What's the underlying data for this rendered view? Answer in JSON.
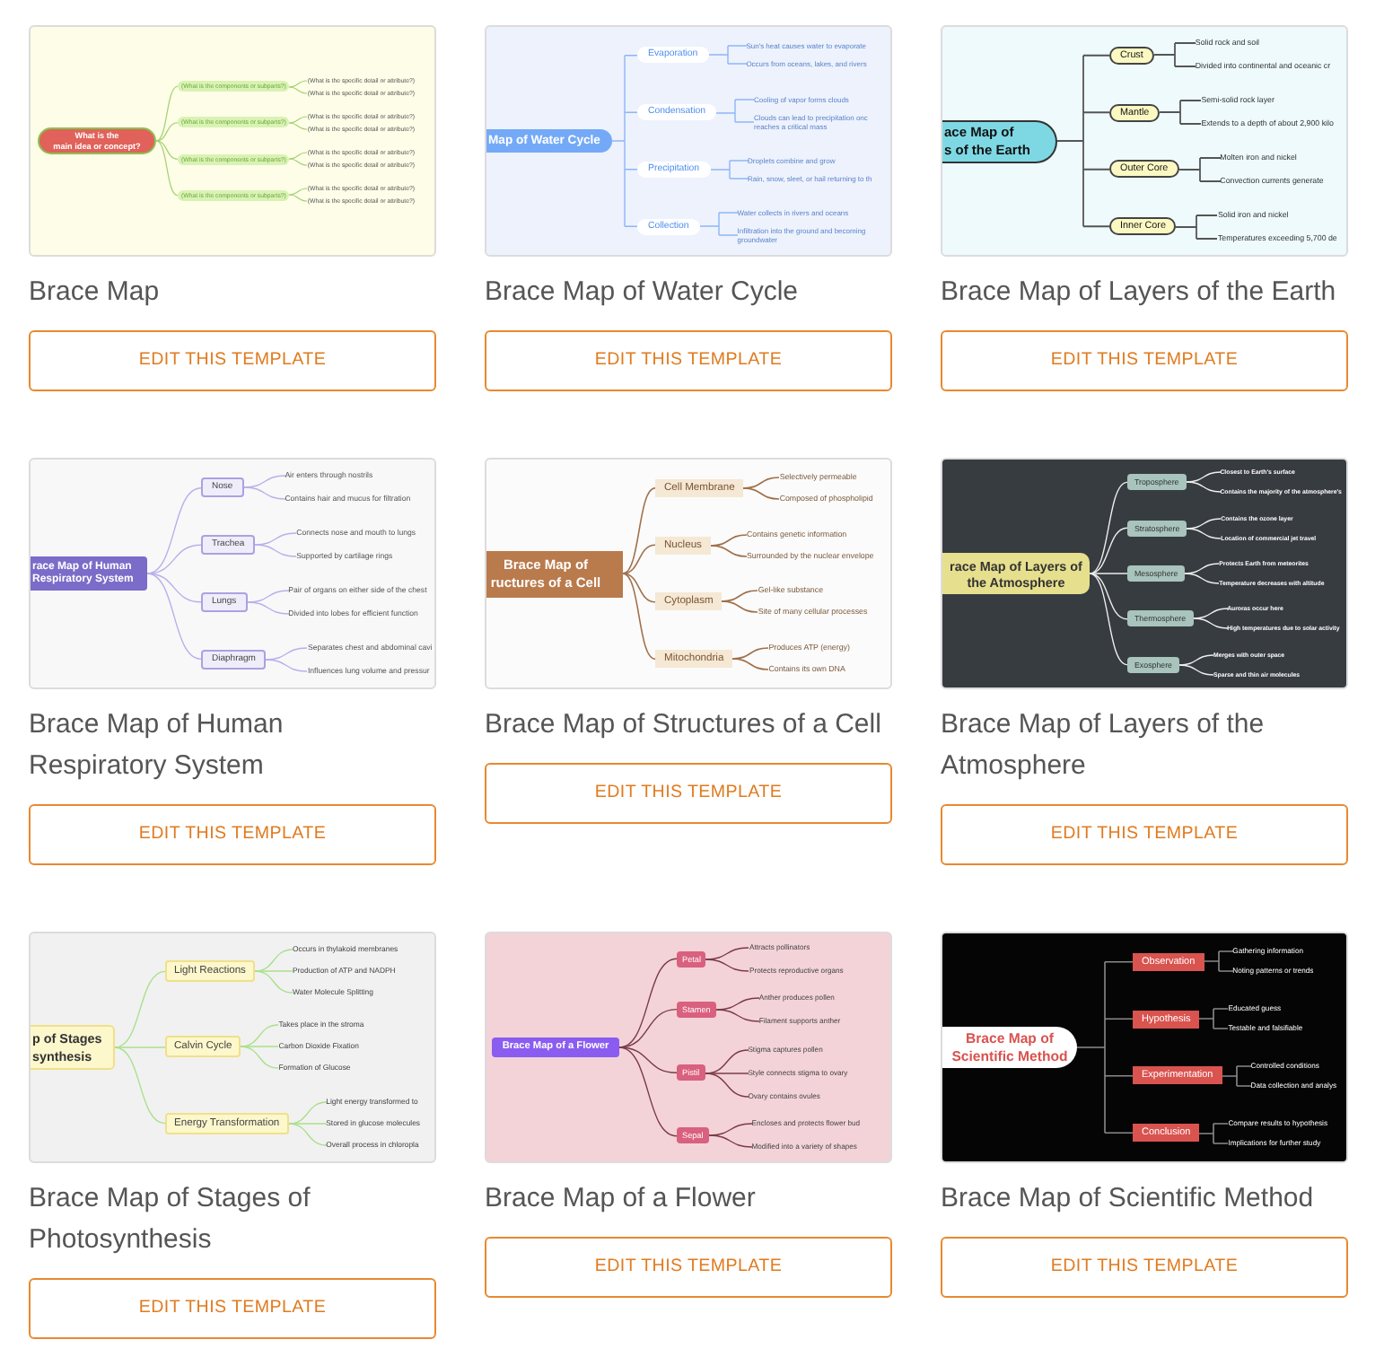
{
  "templates": [
    {
      "title": "Brace Map",
      "preview": {
        "kind": "curved",
        "root": "What is the\nmain idea or concept?",
        "branches": [
          {
            "label": "(What is the components or subparts?)",
            "details": [
              "(What is the specific detail or attribute?)",
              "(What is the specific detail or attribute?)"
            ]
          },
          {
            "label": "(What is the components or subparts?)",
            "details": [
              "(What is the specific detail or attribute?)",
              "(What is the specific detail or attribute?)"
            ]
          },
          {
            "label": "(What is the components or subparts?)",
            "details": [
              "(What is the specific detail or attribute?)",
              "(What is the specific detail or attribute?)"
            ]
          },
          {
            "label": "(What is the components or subparts?)",
            "details": [
              "(What is the specific detail or attribute?)",
              "(What is the specific detail or attribute?)"
            ]
          }
        ]
      },
      "button": "EDIT THIS TEMPLATE"
    },
    {
      "title": "Brace Map of Water Cycle",
      "preview": {
        "kind": "angular",
        "root": "Map of Water Cycle",
        "branches": [
          {
            "label": "Evaporation",
            "details": [
              "Sun's heat causes water to evaporate",
              "Occurs from oceans, lakes, and rivers"
            ]
          },
          {
            "label": "Condensation",
            "details": [
              "Cooling of vapor forms clouds",
              "Clouds can lead to precipitation onc\nreaches a critical mass"
            ]
          },
          {
            "label": "Precipitation",
            "details": [
              "Droplets combine and grow",
              "Rain, snow, sleet, or hail returning to th"
            ]
          },
          {
            "label": "Collection",
            "details": [
              "Water collects in rivers and oceans",
              "Infiltration into the ground and becoming\ngroundwater"
            ]
          }
        ]
      },
      "button": "EDIT THIS TEMPLATE"
    },
    {
      "title": "Brace Map of Layers of the Earth",
      "preview": {
        "kind": "angular",
        "root": "ace Map of\ns of the Earth",
        "branches": [
          {
            "label": "Crust",
            "details": [
              "Solid rock and soil",
              "Divided into continental and oceanic cr"
            ]
          },
          {
            "label": "Mantle",
            "details": [
              "Semi-solid rock layer",
              "Extends to a depth of about 2,900 kilo"
            ]
          },
          {
            "label": "Outer Core",
            "details": [
              "Molten iron and nickel",
              "Convection currents generate"
            ]
          },
          {
            "label": "Inner Core",
            "details": [
              "Solid iron and nickel",
              "Temperatures exceeding 5,700 de"
            ]
          }
        ]
      },
      "button": "EDIT THIS TEMPLATE"
    },
    {
      "title": "Brace Map of Human Respiratory System",
      "preview": {
        "kind": "curved",
        "root": "race Map of Human\nRespiratory System",
        "branches": [
          {
            "label": "Nose",
            "details": [
              "Air enters through nostrils",
              "Contains hair and mucus for filtration"
            ]
          },
          {
            "label": "Trachea",
            "details": [
              "Connects nose and mouth to lungs",
              "Supported by cartilage rings"
            ]
          },
          {
            "label": "Lungs",
            "details": [
              "Pair of organs on either side of the chest",
              "Divided into lobes for efficient function"
            ]
          },
          {
            "label": "Diaphragm",
            "details": [
              "Separates chest and abdominal cavi",
              "Influences lung volume and pressur"
            ]
          }
        ]
      },
      "button": "EDIT THIS TEMPLATE"
    },
    {
      "title": "Brace Map of Structures of a Cell",
      "preview": {
        "kind": "curved",
        "root": "Brace Map of\nructures of a Cell",
        "branches": [
          {
            "label": "Cell Membrane",
            "details": [
              "Selectively permeable",
              "Composed of phospholipid"
            ]
          },
          {
            "label": "Nucleus",
            "details": [
              "Contains genetic information",
              "Surrounded by the nuclear envelope"
            ]
          },
          {
            "label": "Cytoplasm",
            "details": [
              "Gel-like substance",
              "Site of many cellular processes"
            ]
          },
          {
            "label": "Mitochondria",
            "details": [
              "Produces ATP (energy)",
              "Contains its own DNA"
            ]
          }
        ]
      },
      "button": "EDIT THIS TEMPLATE"
    },
    {
      "title": "Brace Map of Layers of the Atmosphere",
      "preview": {
        "kind": "curved",
        "root": "race Map of Layers of\nthe Atmosphere",
        "branches": [
          {
            "label": "Troposphere",
            "details": [
              "Closest to Earth's surface",
              "Contains the majority of the atmosphere's"
            ]
          },
          {
            "label": "Stratosphere",
            "details": [
              "Contains the ozone layer",
              "Location of commercial jet travel"
            ]
          },
          {
            "label": "Mesosphere",
            "details": [
              "Protects Earth from meteorites",
              "Temperature decreases with altitude"
            ]
          },
          {
            "label": "Thermosphere",
            "details": [
              "Auroras occur here",
              "High temperatures due to solar activity"
            ]
          },
          {
            "label": "Exosphere",
            "details": [
              "Merges with outer space",
              "Sparse and thin air molecules"
            ]
          }
        ]
      },
      "button": "EDIT THIS TEMPLATE"
    },
    {
      "title": "Brace Map of Stages of Photosynthesis",
      "preview": {
        "kind": "curved",
        "root": "p of Stages\nsynthesis",
        "branches": [
          {
            "label": "Light Reactions",
            "details": [
              "Occurs in thylakoid membranes",
              "Production of ATP and NADPH",
              "Water Molecule Splitting"
            ]
          },
          {
            "label": "Calvin Cycle",
            "details": [
              "Takes place in the stroma",
              "Carbon Dioxide Fixation",
              "Formation of Glucose"
            ]
          },
          {
            "label": "Energy Transformation",
            "details": [
              "Light energy transformed to",
              "Stored in glucose molecules",
              "Overall process in chloropla"
            ]
          }
        ]
      },
      "button": "EDIT THIS TEMPLATE"
    },
    {
      "title": "Brace Map of a Flower",
      "preview": {
        "kind": "curved",
        "root": "Brace Map of a Flower",
        "branches": [
          {
            "label": "Petal",
            "details": [
              "Attracts pollinators",
              "Protects reproductive organs"
            ]
          },
          {
            "label": "Stamen",
            "details": [
              "Anther produces pollen",
              "Filament supports anther"
            ]
          },
          {
            "label": "Pistil",
            "details": [
              "Stigma captures pollen",
              "Style connects stigma to ovary",
              "Ovary contains ovules"
            ]
          },
          {
            "label": "Sepal",
            "details": [
              "Encloses and protects flower bud",
              "Modified into a variety of shapes"
            ]
          }
        ]
      },
      "button": "EDIT THIS TEMPLATE"
    },
    {
      "title": "Brace Map of Scientific Method",
      "preview": {
        "kind": "angular",
        "root": "Brace Map of\nScientific Method",
        "branches": [
          {
            "label": "Observation",
            "details": [
              "Gathering information",
              "Noting patterns or trends"
            ]
          },
          {
            "label": "Hypothesis",
            "details": [
              "Educated guess",
              "Testable and falsifiable"
            ]
          },
          {
            "label": "Experimentation",
            "details": [
              "Controlled conditions",
              "Data collection and analys"
            ]
          },
          {
            "label": "Conclusion",
            "details": [
              "Compare results to hypothesis",
              "Implications for further study"
            ]
          }
        ]
      },
      "button": "EDIT THIS TEMPLATE"
    }
  ]
}
